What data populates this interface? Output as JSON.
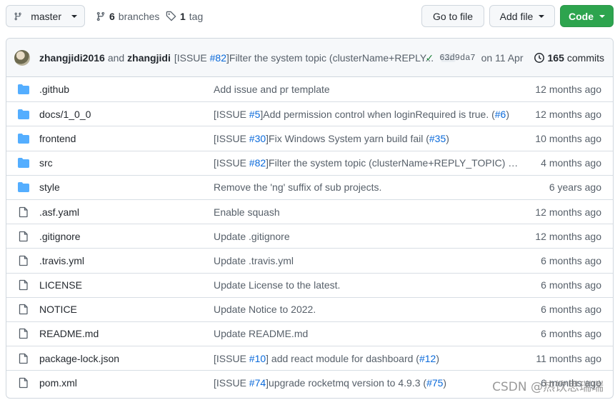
{
  "toolbar": {
    "branch_label": "master",
    "branches_count": "6",
    "branches_label": "branches",
    "tags_count": "1",
    "tags_label": "tag",
    "goto_file_label": "Go to file",
    "add_file_label": "Add file",
    "code_label": "Code"
  },
  "commit": {
    "author1": "zhangjidi2016",
    "and": "and",
    "author2": "zhangjidi",
    "message_prefix": "[ISSUE ",
    "message_link": "#82",
    "message_rest": "]Filter the system topic (clusterName+REPLY...",
    "ellipsis": "…",
    "sha": "63d9da7",
    "date": "on 11 Apr",
    "commits_count": "165",
    "commits_label": "commits"
  },
  "files": [
    {
      "type": "folder",
      "name": ".github",
      "msg_pre": "Add issue and pr template",
      "msg_link": "",
      "msg_mid": "",
      "msg_link2": "",
      "msg_post": "",
      "age": "12 months ago"
    },
    {
      "type": "folder",
      "name": "docs/1_0_0",
      "msg_pre": "[ISSUE ",
      "msg_link": "#5",
      "msg_mid": "]Add permission control when loginRequired is true. (",
      "msg_link2": "#6",
      "msg_post": ")",
      "age": "12 months ago"
    },
    {
      "type": "folder",
      "name": "frontend",
      "msg_pre": "[ISSUE ",
      "msg_link": "#30",
      "msg_mid": "]Fix Windows System yarn build fail (",
      "msg_link2": "#35",
      "msg_post": ")",
      "age": "10 months ago"
    },
    {
      "type": "folder",
      "name": "src",
      "msg_pre": "[ISSUE ",
      "msg_link": "#82",
      "msg_mid": "]Filter the system topic (clusterName+REPLY_TOPIC) when da...",
      "msg_link2": "",
      "msg_post": "",
      "age": "4 months ago"
    },
    {
      "type": "folder",
      "name": "style",
      "msg_pre": "Remove the 'ng' suffix of sub projects.",
      "msg_link": "",
      "msg_mid": "",
      "msg_link2": "",
      "msg_post": "",
      "age": "6 years ago"
    },
    {
      "type": "file",
      "name": ".asf.yaml",
      "msg_pre": "Enable squash",
      "msg_link": "",
      "msg_mid": "",
      "msg_link2": "",
      "msg_post": "",
      "age": "12 months ago"
    },
    {
      "type": "file",
      "name": ".gitignore",
      "msg_pre": "Update .gitignore",
      "msg_link": "",
      "msg_mid": "",
      "msg_link2": "",
      "msg_post": "",
      "age": "12 months ago"
    },
    {
      "type": "file",
      "name": ".travis.yml",
      "msg_pre": "Update .travis.yml",
      "msg_link": "",
      "msg_mid": "",
      "msg_link2": "",
      "msg_post": "",
      "age": "6 months ago"
    },
    {
      "type": "file",
      "name": "LICENSE",
      "msg_pre": "Update License to the latest.",
      "msg_link": "",
      "msg_mid": "",
      "msg_link2": "",
      "msg_post": "",
      "age": "6 months ago"
    },
    {
      "type": "file",
      "name": "NOTICE",
      "msg_pre": "Update Notice to 2022.",
      "msg_link": "",
      "msg_mid": "",
      "msg_link2": "",
      "msg_post": "",
      "age": "6 months ago"
    },
    {
      "type": "file",
      "name": "README.md",
      "msg_pre": "Update README.md",
      "msg_link": "",
      "msg_mid": "",
      "msg_link2": "",
      "msg_post": "",
      "age": "6 months ago"
    },
    {
      "type": "file",
      "name": "package-lock.json",
      "msg_pre": "[ISSUE ",
      "msg_link": "#10",
      "msg_mid": "] add react module for dashboard (",
      "msg_link2": "#12",
      "msg_post": ")",
      "age": "11 months ago"
    },
    {
      "type": "file",
      "name": "pom.xml",
      "msg_pre": "[ISSUE ",
      "msg_link": "#74",
      "msg_mid": "]upgrade rocketmq version to 4.9.3 (",
      "msg_link2": "#75",
      "msg_post": ")",
      "age": "6 months ago"
    }
  ],
  "watermark": "CSDN @热饮思瑞瑞",
  "colors": {
    "folder": "#54aeff",
    "link": "#0969da",
    "code_button": "#2da44e",
    "check": "#1a7f37"
  }
}
